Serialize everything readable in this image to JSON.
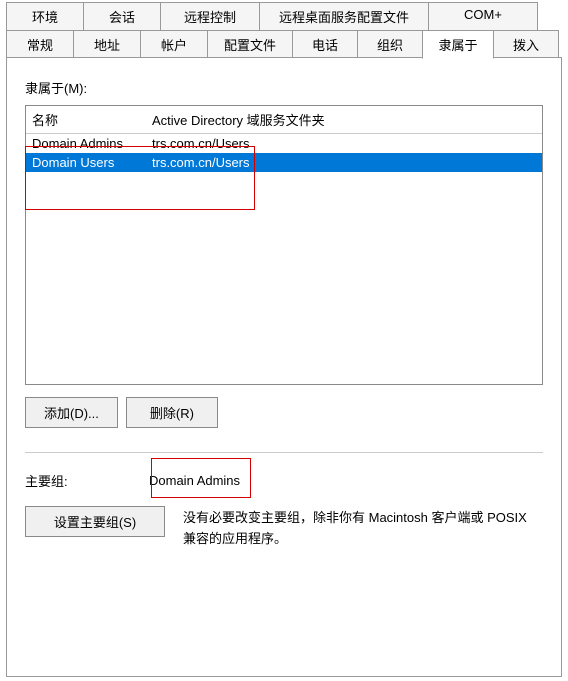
{
  "tabs": {
    "row1": [
      {
        "id": "env",
        "label": "环境"
      },
      {
        "id": "session",
        "label": "会话"
      },
      {
        "id": "remote",
        "label": "远程控制"
      },
      {
        "id": "rds",
        "label": "远程桌面服务配置文件"
      },
      {
        "id": "com",
        "label": "COM+"
      }
    ],
    "row2": [
      {
        "id": "general",
        "label": "常规"
      },
      {
        "id": "address",
        "label": "地址"
      },
      {
        "id": "account",
        "label": "帐户"
      },
      {
        "id": "config",
        "label": "配置文件"
      },
      {
        "id": "phone",
        "label": "电话"
      },
      {
        "id": "org",
        "label": "组织"
      },
      {
        "id": "member",
        "label": "隶属于",
        "active": true
      },
      {
        "id": "dial",
        "label": "拨入"
      }
    ]
  },
  "memberOf": {
    "label": "隶属于(M):",
    "columns": {
      "name": "名称",
      "folder": "Active Directory 域服务文件夹"
    },
    "rows": [
      {
        "name": "Domain Admins",
        "folder": "trs.com.cn/Users",
        "selected": false
      },
      {
        "name": "Domain Users",
        "folder": "trs.com.cn/Users",
        "selected": true
      }
    ]
  },
  "buttons": {
    "add": "添加(D)...",
    "remove": "删除(R)",
    "setPrimary": "设置主要组(S)"
  },
  "primaryGroup": {
    "label": "主要组:",
    "value": "Domain Admins",
    "desc": "没有必要改变主要组，除非你有 Macintosh 客户端或 POSIX 兼容的应用程序。"
  }
}
